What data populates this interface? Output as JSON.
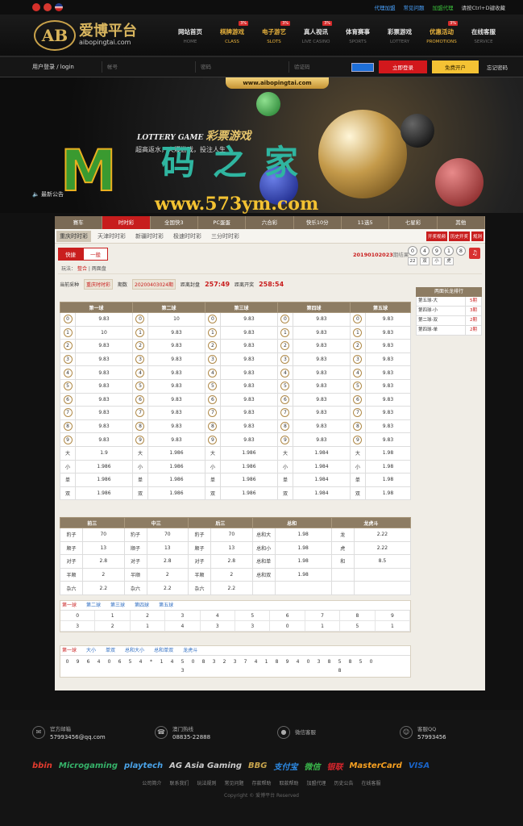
{
  "topbar": {
    "links": [
      "代理加盟",
      "常见问题",
      "加盟代理",
      "请按Ctrl+D键收藏"
    ]
  },
  "logo": {
    "cn": "爱博平台",
    "en": "aibopingtai.com"
  },
  "nav": [
    {
      "cn": "网站首页",
      "en": "HOME",
      "tag": ""
    },
    {
      "cn": "棋牌游戏",
      "en": "CLASS",
      "tag": "3%"
    },
    {
      "cn": "电子游艺",
      "en": "SLOTS",
      "tag": "3%"
    },
    {
      "cn": "真人视讯",
      "en": "LIVE CASINO",
      "tag": "3%"
    },
    {
      "cn": "体育赛事",
      "en": "SPORTS",
      "tag": ""
    },
    {
      "cn": "彩票游戏",
      "en": "LOTTERY",
      "tag": ""
    },
    {
      "cn": "优惠活动",
      "en": "PROMOTIONS",
      "tag": "3%"
    },
    {
      "cn": "在线客服",
      "en": "SERVICE",
      "tag": ""
    }
  ],
  "login": {
    "label": "用户登录 / login",
    "user_ph": "帐号",
    "pass_ph": "密码",
    "code_ph": "验证码",
    "login_btn": "立即登录",
    "register_btn": "免费开户",
    "forgot": "忘记密码"
  },
  "banner": {
    "url": "www.aibopingtai.com",
    "title_en": "LOTTERY GAME",
    "title_cn": "彩票游戏",
    "subtitle": "超高返水，火爆游戏，投注人生",
    "notice": "最新公告",
    "wm_cn": "码之家",
    "wm_url": "www.573ym.com"
  },
  "gametabs": [
    "赛车",
    "时时彩",
    "全国快3",
    "PC蛋蛋",
    "六合彩",
    "快乐10分",
    "11选5",
    "七星彩",
    "其他"
  ],
  "subtabs": [
    "重庆时时彩",
    "天津时时彩",
    "新疆时时彩",
    "极速时时彩",
    "三分时时彩"
  ],
  "subright": [
    "开奖视频",
    "历史开奖",
    "规则"
  ],
  "modes": [
    "快捷",
    "一般"
  ],
  "issue": {
    "number": "20190102023",
    "suffix": "期结果"
  },
  "result_balls": [
    "0",
    "4",
    "9",
    "1",
    "8"
  ],
  "result_tags": [
    "22",
    "双",
    "小",
    "虎"
  ],
  "playtype": {
    "label": "玩法：",
    "active": "整合",
    "rest": "| 两面盘"
  },
  "curinfo": {
    "l1": "当前采种",
    "v1": "重庆时时彩",
    "l2": "期数",
    "v2": "20200403024期",
    "l3": "距离封盘",
    "v3": "257:49",
    "l4": "距离开奖",
    "v4": "258:54"
  },
  "ranking": {
    "title": "两面长龙排行",
    "rows": [
      [
        "第五球-大",
        "5期"
      ],
      [
        "第四球-小",
        "3期"
      ],
      [
        "第二球-双",
        "2期"
      ],
      [
        "第四球-单",
        "2期"
      ]
    ]
  },
  "table1": {
    "headers": [
      "第一球",
      "第二球",
      "第三球",
      "第四球",
      "第五球"
    ],
    "rows": [
      [
        "0",
        "9.83",
        "10",
        "9.83",
        "9.83",
        "9.83",
        "9.83"
      ],
      [
        "1",
        "10",
        "9.83",
        "9.83",
        "9.83",
        "9.83",
        "9.83"
      ],
      [
        "2",
        "9.83",
        "9.83",
        "9.83",
        "9.83",
        "9.83",
        "9.83"
      ],
      [
        "3",
        "9.83",
        "9.83",
        "9.83",
        "9.83",
        "9.83",
        "9.83"
      ],
      [
        "4",
        "9.83",
        "9.83",
        "9.83",
        "9.83",
        "9.83",
        "9.83"
      ],
      [
        "5",
        "9.83",
        "9.83",
        "9.83",
        "9.83",
        "9.83",
        "9.83"
      ],
      [
        "6",
        "9.83",
        "9.83",
        "9.83",
        "9.83",
        "9.83",
        "9.83"
      ],
      [
        "7",
        "9.83",
        "9.83",
        "9.83",
        "9.83",
        "9.83",
        "9.83"
      ],
      [
        "8",
        "9.83",
        "9.83",
        "9.83",
        "9.83",
        "9.83",
        "9.83"
      ],
      [
        "9",
        "9.83",
        "9.83",
        "9.83",
        "9.83",
        "9.83",
        "9.83"
      ]
    ],
    "col1": [
      "9.83",
      "10",
      "9.83",
      "9.83",
      "9.83",
      "9.83",
      "9.83",
      "9.83",
      "9.83",
      "9.83"
    ],
    "text_rows": [
      [
        "大",
        "1.9",
        "1.986",
        "1.986",
        "1.984",
        "1.98"
      ],
      [
        "小",
        "1.986",
        "1.986",
        "1.986",
        "1.984",
        "1.98"
      ],
      [
        "单",
        "1.986",
        "1.986",
        "1.986",
        "1.984",
        "1.98"
      ],
      [
        "双",
        "1.986",
        "1.986",
        "1.986",
        "1.984",
        "1.98"
      ]
    ]
  },
  "table2": {
    "headers": [
      "前三",
      "中三",
      "后三",
      "总和",
      "龙虎斗"
    ],
    "rows": [
      [
        "豹子",
        "70",
        "豹子",
        "70",
        "豹子",
        "70",
        "总和大",
        "1.98",
        "龙",
        "2.22"
      ],
      [
        "顺子",
        "13",
        "顺子",
        "13",
        "顺子",
        "13",
        "总和小",
        "1.98",
        "虎",
        "2.22"
      ],
      [
        "对子",
        "2.8",
        "对子",
        "2.8",
        "对子",
        "2.8",
        "总和单",
        "1.98",
        "和",
        "8.5"
      ],
      [
        "半顺",
        "2",
        "半顺",
        "2",
        "半顺",
        "2",
        "总和双",
        "1.98",
        "",
        ""
      ],
      [
        "杂六",
        "2.2",
        "杂六",
        "2.2",
        "杂六",
        "2.2",
        "",
        "",
        "",
        ""
      ]
    ]
  },
  "trend1": {
    "tabs": [
      "第一球",
      "第二球",
      "第三球",
      "第四球",
      "第五球"
    ],
    "row1": [
      "0",
      "1",
      "2",
      "3",
      "4",
      "5",
      "6",
      "7",
      "8",
      "9"
    ],
    "row2": [
      "3",
      "2",
      "1",
      "4",
      "3",
      "3",
      "0",
      "1",
      "5",
      "1"
    ]
  },
  "trend2": {
    "tabs": [
      "第一球",
      "大小",
      "单双",
      "总和大小",
      "总和单双",
      "龙虎斗"
    ],
    "cells": [
      "0",
      "9",
      "6",
      "4",
      "0",
      "6",
      "5",
      "4",
      "*",
      "1",
      "4",
      "5",
      "0",
      "8",
      "3",
      "2",
      "3",
      "7",
      "4",
      "1",
      "8",
      "9",
      "4",
      "0",
      "3",
      "8",
      "5",
      "8",
      "5",
      "0",
      "",
      "",
      "",
      "",
      "",
      "",
      "",
      "",
      "",
      "",
      "",
      "",
      "",
      "",
      "3",
      "",
      "",
      "",
      "",
      "",
      "",
      "",
      "",
      "",
      "",
      "",
      "",
      "",
      "",
      "8"
    ]
  },
  "footer": {
    "contacts": [
      {
        "icon": "mail-icon",
        "t1": "官方邮箱",
        "t2": "57993456@qq.com"
      },
      {
        "icon": "phone-icon",
        "t1": "澳门热线",
        "t2": "08835-22888"
      },
      {
        "icon": "wechat-icon",
        "t1": "微信客服",
        "t2": ""
      },
      {
        "icon": "qq-icon",
        "t1": "客服QQ",
        "t2": "57993456"
      }
    ],
    "partners": [
      {
        "name": "bbin",
        "color": "#e23b2e"
      },
      {
        "name": "Microgaming",
        "color": "#36b36a"
      },
      {
        "name": "playtech",
        "color": "#4aa3e8"
      },
      {
        "name": "AG Asia Gaming",
        "color": "#ccc"
      },
      {
        "name": "BBG",
        "color": "#c6a34c"
      },
      {
        "name": "支付宝",
        "color": "#2d8ce8"
      },
      {
        "name": "微信",
        "color": "#39b54a"
      },
      {
        "name": "银联",
        "color": "#d8262d"
      },
      {
        "name": "MasterCard",
        "color": "#f6a021"
      },
      {
        "name": "VISA",
        "color": "#1a64c8"
      }
    ],
    "links": [
      "公司简介",
      "联系我们",
      "玩法规则",
      "常见问题",
      "存款帮助",
      "取款帮助",
      "加盟代理",
      "历史公告",
      "在线客服"
    ],
    "copyright": "Copyright © 爱博平台 Reserved"
  }
}
